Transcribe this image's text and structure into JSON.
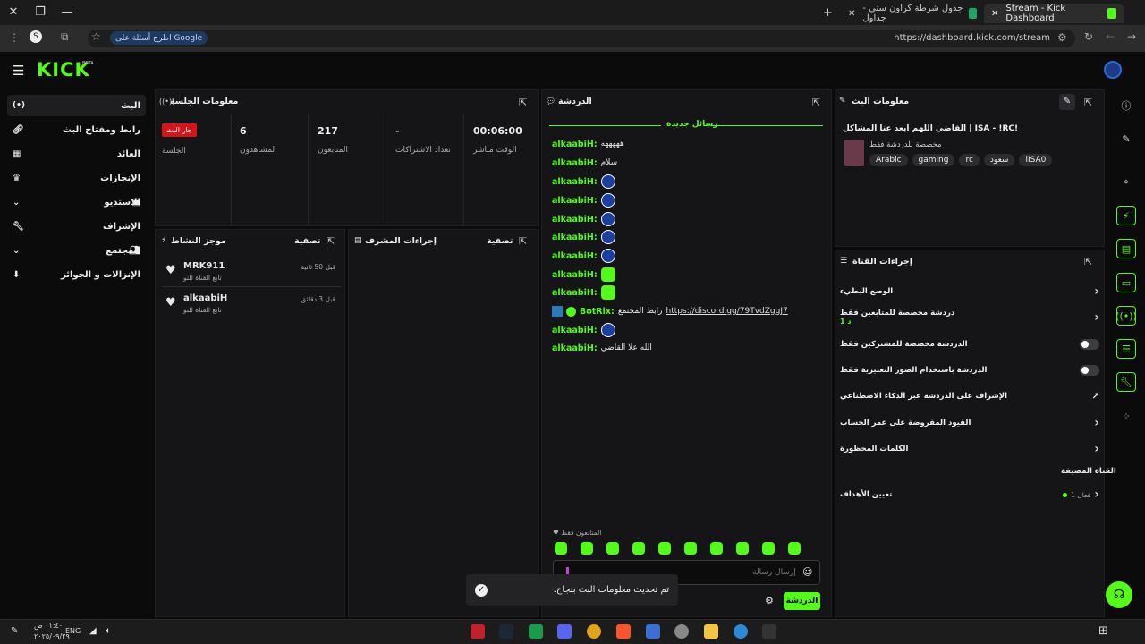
{
  "browser": {
    "tabs": [
      {
        "label": "Stream - Kick Dashboard"
      },
      {
        "label": "جدول شرطة كراون ستي - جداول"
      }
    ],
    "url": "https://dashboard.kick.com/stream",
    "google_button": "اطرح أسئلة على Google"
  },
  "header": {
    "logo": "KICK",
    "beta": "BETA"
  },
  "nav": {
    "items": [
      {
        "label": "البث"
      },
      {
        "label": "رابط ومفتاح البث"
      },
      {
        "label": "العائد"
      },
      {
        "label": "الإنجازات"
      },
      {
        "label": "الاستديو"
      },
      {
        "label": "الإشراف"
      },
      {
        "label": "المجتمع"
      },
      {
        "label": "الإنزالات و الجوائز"
      }
    ]
  },
  "session": {
    "title": "معلومات الجلسة",
    "live_badge": "جار البث",
    "session_label": "الجلسة",
    "stats": [
      {
        "value": "6",
        "label": "المشاهدون"
      },
      {
        "value": "217",
        "label": "المتابعون"
      },
      {
        "value": "-",
        "label": "تعداد الاشتراكات"
      },
      {
        "value": "00:06:00",
        "label": "الوقت مباشر"
      }
    ]
  },
  "activity": {
    "title": "موجز النشاط",
    "filter": "تصفية",
    "items": [
      {
        "name": "MRK911",
        "sub": "تابع القناة للتو",
        "time": "قبل 50 ثانية"
      },
      {
        "name": "alkaabiH",
        "sub": "تابع القناة للتو",
        "time": "قبل 3 دقائق"
      }
    ]
  },
  "mod": {
    "title": "إجراءات المشرف",
    "filter": "تصفية"
  },
  "chat": {
    "title": "الدردشة",
    "new_messages": "رسائل جديدة",
    "lines": [
      {
        "user": "alkaabiH:",
        "text": "هههههه"
      },
      {
        "user": "alkaabiH:",
        "text": "سلام"
      },
      {
        "user": "alkaabiH:",
        "text": ""
      },
      {
        "user": "alkaabiH:",
        "text": ""
      },
      {
        "user": "alkaabiH:",
        "text": ""
      },
      {
        "user": "alkaabiH:",
        "text": ""
      },
      {
        "user": "alkaabiH:",
        "text": ""
      },
      {
        "user": "alkaabiH:",
        "text": ""
      },
      {
        "user": "alkaabiH:",
        "text": ""
      },
      {
        "user": "BotRix:",
        "text": "رابط المجتمع",
        "link": "https://discord.gg/79TvdZggJ7"
      },
      {
        "user": "alkaabiH:",
        "text": ""
      },
      {
        "user": "alkaabiH:",
        "text": "الله علا القاضي"
      }
    ],
    "followers_only": "المتابعون فقط",
    "placeholder": "إرسال رسالة",
    "send": "الدردشة"
  },
  "toast": {
    "text": ".تم تحديث معلومات البث بنجاح"
  },
  "stream_info": {
    "title": "معلومات البث",
    "stream_title": "القاضي اللهم ابعد عنا المشاكل | ISA - !RC!",
    "category": "مخصصة للدردشة فقط",
    "tags": [
      "Arabic",
      "gaming",
      "rc",
      "سعود",
      "iISA0"
    ]
  },
  "channel": {
    "title": "إجراءات القناة",
    "rows": [
      {
        "label": "الوضع البطيء"
      },
      {
        "label": "دردشة مخصصة للمتابعين فقط",
        "sub": "1 د"
      },
      {
        "label": "الدردشة مخصصة للمشتركين فقط"
      },
      {
        "label": "الدردشة باستخدام الصور التعبيرية فقط"
      },
      {
        "label": "الإشراف على الدردشة عبر الذكاء الاصطناعي"
      },
      {
        "label": "القيود المفروضة على عمر الحساب"
      },
      {
        "label": "الكلمات المحظورة"
      }
    ],
    "host_label": "القناة المضيفة",
    "goals_label": "تعيين الأهداف",
    "goals_status": "فعال 1"
  },
  "taskbar": {
    "lang": "ENG",
    "time": "٠١:٤٠ ص",
    "date": "٢٠٢٥/٠٩/٢٩"
  }
}
